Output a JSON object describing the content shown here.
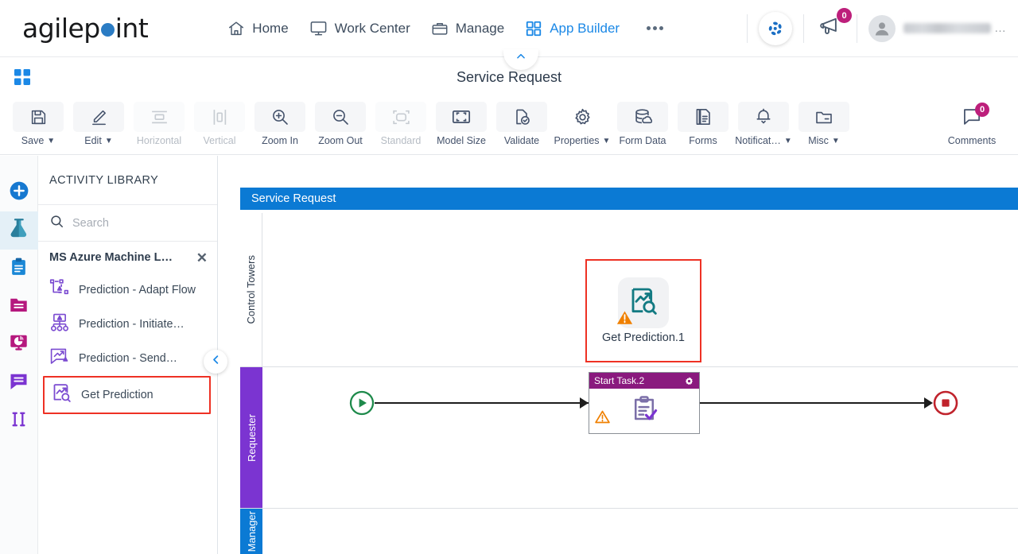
{
  "header": {
    "logo_text_before": "agilep",
    "logo_text_after": "int",
    "nav": [
      {
        "label": "Home",
        "icon": "home-icon",
        "active": false
      },
      {
        "label": "Work Center",
        "icon": "monitor-icon",
        "active": false
      },
      {
        "label": "Manage",
        "icon": "briefcase-icon",
        "active": false
      },
      {
        "label": "App Builder",
        "icon": "grid-icon",
        "active": true
      }
    ],
    "more_label": "More",
    "swirl_icon": "agilepoint-swirl-icon",
    "announcement_icon": "megaphone-icon",
    "announcement_count": "0",
    "user_name": "",
    "accent_blue": "#1b88e6",
    "badge_pink": "#bd1f7b"
  },
  "subheader": {
    "apps_icon": "apps-grid-icon",
    "title": "Service Request",
    "collapse_icon": "chevron-up-icon"
  },
  "toolbar": {
    "items": [
      {
        "label": "Save",
        "icon": "save-icon",
        "caret": true,
        "disabled": false
      },
      {
        "label": "Edit",
        "icon": "pencil-icon",
        "caret": true,
        "disabled": false
      },
      {
        "label": "Horizontal",
        "icon": "horizontal-icon",
        "caret": false,
        "disabled": true
      },
      {
        "label": "Vertical",
        "icon": "vertical-icon",
        "caret": false,
        "disabled": true
      },
      {
        "label": "Zoom In",
        "icon": "zoom-in-icon",
        "caret": false,
        "disabled": false
      },
      {
        "label": "Zoom Out",
        "icon": "zoom-out-icon",
        "caret": false,
        "disabled": false
      },
      {
        "label": "Standard",
        "icon": "standard-icon",
        "caret": false,
        "disabled": true
      },
      {
        "label": "Model Size",
        "icon": "model-size-icon",
        "caret": false,
        "disabled": false
      },
      {
        "label": "Validate",
        "icon": "validate-icon",
        "caret": false,
        "disabled": false
      },
      {
        "label": "Properties",
        "icon": "gear-icon",
        "caret": true,
        "disabled": false
      },
      {
        "label": "Form Data",
        "icon": "database-icon",
        "caret": false,
        "disabled": false
      },
      {
        "label": "Forms",
        "icon": "forms-icon",
        "caret": false,
        "disabled": false
      },
      {
        "label": "Notificat…",
        "icon": "bell-icon",
        "caret": true,
        "disabled": false
      },
      {
        "label": "Misc",
        "icon": "folder-icon",
        "caret": true,
        "disabled": false
      }
    ],
    "comments": {
      "label": "Comments",
      "icon": "comment-icon",
      "count": "0"
    }
  },
  "rail": {
    "items": [
      {
        "name": "add-icon",
        "color": "#1678d0",
        "selected": false
      },
      {
        "name": "flask-icon",
        "color": "#36a0bd",
        "selected": true
      },
      {
        "name": "clipboard-icon",
        "color": "#1a87d6",
        "selected": false
      },
      {
        "name": "folder-icon",
        "color": "#b5187e",
        "selected": false
      },
      {
        "name": "analytics-icon",
        "color": "#b5187e",
        "selected": false
      },
      {
        "name": "comment-icon",
        "color": "#7b34d1",
        "selected": false
      },
      {
        "name": "columns-icon",
        "color": "#7b34d1",
        "selected": false
      }
    ]
  },
  "panel": {
    "title": "ACTIVITY LIBRARY",
    "search": {
      "value": "",
      "placeholder": "Search",
      "icon": "search-icon"
    },
    "group": {
      "name": "MS Azure Machine L…",
      "close_icon": "close-icon"
    },
    "activities": [
      {
        "label": "Prediction - Adapt Flow",
        "icon": "prediction-adapt-flow-icon",
        "highlighted": false
      },
      {
        "label": "Prediction - Initiate…",
        "icon": "prediction-initiate-icon",
        "highlighted": false
      },
      {
        "label": "Prediction - Send…",
        "icon": "prediction-send-icon",
        "highlighted": false
      },
      {
        "label": "Get Prediction",
        "icon": "get-prediction-icon",
        "highlighted": true
      }
    ],
    "collapse_icon": "chevron-left-icon",
    "highlight_color": "#ee3124"
  },
  "canvas": {
    "pool_title": "Service Request",
    "pool_color": "#0b7ad4",
    "lanes": [
      {
        "label": "Control Towers",
        "color": "#ffffff"
      },
      {
        "label": "Requester",
        "color": "#7b34d1"
      },
      {
        "label": "Manager",
        "color": "#0b7ad4"
      }
    ],
    "nodes": {
      "get_prediction": {
        "label": "Get Prediction.1",
        "icon": "get-prediction-icon",
        "warning_icon": "warning-icon",
        "highlighted": true
      },
      "start_event": {
        "name": "start-event",
        "icon": "play-icon",
        "color": "#1e8a4b"
      },
      "start_task": {
        "title": "Start Task.2",
        "icon": "task-form-icon",
        "gear_icon": "gear-icon",
        "warning_icon": "warning-icon",
        "header_color": "#8a1a7e"
      },
      "end_event": {
        "name": "end-event",
        "icon": "stop-icon",
        "color": "#c0232c"
      }
    }
  }
}
